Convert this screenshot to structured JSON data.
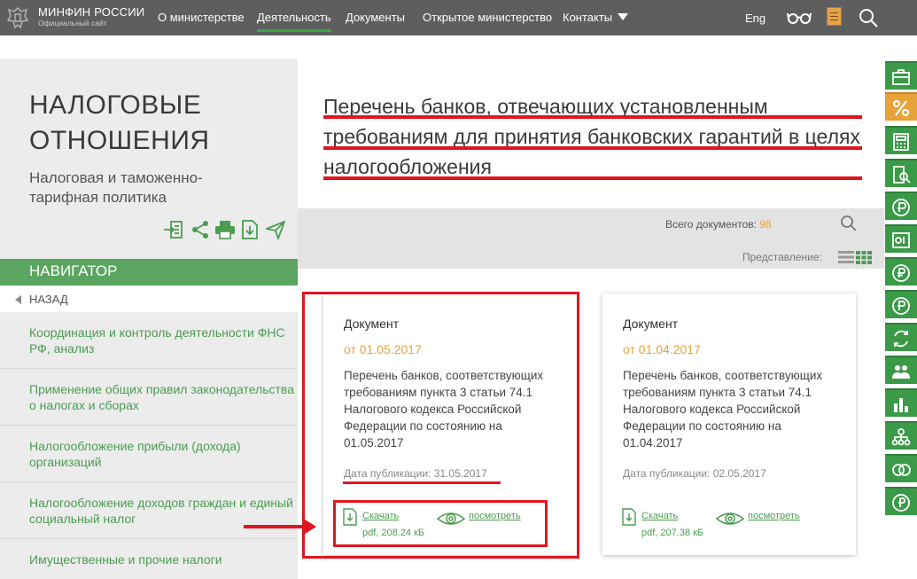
{
  "header": {
    "brand_title": "МИНФИН РОССИИ",
    "brand_subtitle": "Официальный сайт",
    "nav": [
      {
        "label": "О министерстве"
      },
      {
        "label": "Деятельность"
      },
      {
        "label": "Документы"
      },
      {
        "label": "Открытое министерство"
      },
      {
        "label": "Контакты"
      }
    ],
    "lang": "Eng",
    "icons": [
      "coat-of-arms-icon",
      "glasses-icon",
      "book-icon",
      "search-icon"
    ]
  },
  "sidebar": {
    "section_title_line1": "НАЛОГОВЫЕ",
    "section_title_line2": "ОТНОШЕНИЯ",
    "section_subtitle": "Налоговая и таможенно-тарифная политика",
    "tools": [
      "login-icon",
      "share-icon",
      "print-icon",
      "download-icon",
      "send-icon"
    ],
    "navigator_label": "НАВИГАТОР",
    "back_label": "НАЗАД",
    "items": [
      {
        "label": "Координация и контроль деятельности ФНС РФ, анализ"
      },
      {
        "label": "Применение общих правил законодательства о налогах и сборах"
      },
      {
        "label": "Налогообложение прибыли (дохода) организаций"
      },
      {
        "label": "Налогообложение доходов граждан и единый социальный налог"
      },
      {
        "label": "Имущественные и прочие налоги"
      }
    ]
  },
  "main": {
    "title": "Перечень банков, отвечающих установленным требованиям для принятия банковских гарантий в целях налогообложения",
    "total_label": "Всего документов:",
    "total_count": "98",
    "view_label": "Представление:",
    "cards": [
      {
        "kind": "Документ",
        "date": "от 01.05.2017",
        "description": "Перечень банков, соответствующих требованиям пункта 3 статьи 74.1 Налогового кодекса Российской Федерации по состоянию на 01.05.2017",
        "published": "Дата публикации: 31.05.2017",
        "download_label": "Скачать",
        "file_info": "pdf, 208.24 кБ",
        "view_label": "посмотреть"
      },
      {
        "kind": "Документ",
        "date": "от 01.04.2017",
        "description": "Перечень банков, соответствующих требованиям пункта 3 статьи 74.1 Налогового кодекса Российской Федерации по состоянию на 01.04.2017",
        "published": "Дата публикации: 02.05.2017",
        "download_label": "Скачать",
        "file_info": "pdf, 207.38 кБ",
        "view_label": "посмотреть"
      }
    ]
  },
  "right_rail": {
    "icons": [
      "briefcase-icon",
      "percent-icon",
      "calculator-icon",
      "report-search-icon",
      "ruble-globe-icon",
      "document-ruble-icon",
      "ruble-coin-icon",
      "ruble-chart-icon",
      "currency-exchange-icon",
      "people-icon",
      "bar-chart-icon",
      "network-icon",
      "ruble-chain-icon",
      "ruble-badge-icon"
    ]
  },
  "colors": {
    "topbar": "#5e5e5e",
    "accent_green": "#4a9d50",
    "navigator_green": "#5aa55f",
    "date_orange": "#e8a23a",
    "annotation_red": "#e0161f",
    "sidebar_bg": "#ececec"
  }
}
